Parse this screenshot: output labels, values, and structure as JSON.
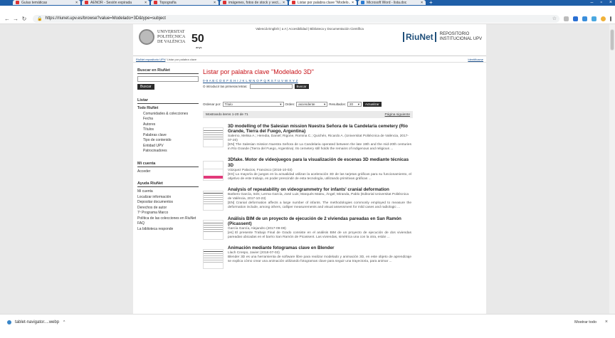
{
  "browser": {
    "tabs": [
      {
        "label": "Guías temáticas"
      },
      {
        "label": "AENOR - Sesión expirada"
      },
      {
        "label": "Topografía"
      },
      {
        "label": "imágenes, fotos de stock y vect..."
      },
      {
        "label": "Listar por palabra clave \"Modelo..."
      },
      {
        "label": "Microsoft Word - lista.doc"
      }
    ],
    "url": "https://riunet.upv.es/browse?value=Modelado+3D&type=subject"
  },
  "header": {
    "top_links": "Valencià   English  |  a A  |  Accesibilidad  |  Biblioteca y Documentación Científica",
    "upv_line1": "UNIVERSITAT",
    "upv_line2": "POLITÈCNICA",
    "upv_line3": "DE VALÈNCIA",
    "anys_number": "50",
    "anys_word": "anys",
    "riunet_brand": "RiuNet",
    "repo_line1": "REPOSITORIO",
    "repo_line2": "INSTITUCIONAL UPV"
  },
  "breadcrumb": {
    "link": "RiuNet repositorio UPV",
    "current": " / Listar por palabra clave",
    "right_link": "Identificarse"
  },
  "sidebar": {
    "search_heading": "Buscar en RiuNet",
    "search_button": "Buscar",
    "list_heading": "Listar",
    "all_label": "Todo RiuNet",
    "list_items": [
      "Comunidades & colecciones",
      "Fecha",
      "Autores",
      "Títulos",
      "Palabras clave",
      "Tipo de contenido",
      "Entidad UPV",
      "Patrocinadores"
    ],
    "account_heading": "Mi cuenta",
    "account_items": [
      "Acceder"
    ],
    "help_heading": "Ayuda RiuNet",
    "help_items": [
      "Mi cuenta",
      "Localizar información",
      "Depositar documentos",
      "Derechos de autor",
      "7º Programa Marco",
      "Política de las colecciones en RiuNet",
      "FAQ",
      "La biblioteca responde"
    ]
  },
  "main": {
    "title": "Listar por palabra clave \"Modelado 3D\"",
    "alphabet": "0-9 A B C D E F G H I J K L M N O P Q R S T U V W X Y Z",
    "jump_label": "O introducir las primeras letras:",
    "jump_button": "Buscar",
    "sort_label": "Ordenar por:",
    "sort_value": "Título",
    "order_label": "Orden:",
    "order_value": "ascendente",
    "results_label": "Resultados:",
    "results_value": "20",
    "update_button": "Actualizar",
    "showing": "Mostrando items 1-20 de 71",
    "next_page": "Página siguiente",
    "items": [
      {
        "title": "3D modelling of the Salesian mission Nuestra Señora de la Candelaria cemetery (Rio Grande, Tierra del Fuego, Argentina)",
        "meta": "Salerno, Melisa A.; Heredia, Daniel; Rigone, Romina C.; Quichén, Ricardo A. (Universitat Politècnica de València, 2017-07-20)",
        "abstract": "[EN] The Salesian mission Nuestra Señora de La Candelaria operated between the late 19th and the mid-20th centuries in Río Grande (Tierra del Fuego, Argentina). Its cemetery still holds the remains of indigenous and religious ..."
      },
      {
        "title": "3Dfake. Motor de videojuegos para la visualización de escenas 3D mediante técnicas 3D",
        "meta": "Vázquez Palacios, Francisco (2016-10-03)",
        "abstract": "[ES] La mayoría de juegos en la actualidad utilizan la aceleración 3D de las tarjetas gráficas para su funcionamiento, el objetivo de este trabajo, es poder prescindir de esta tecnología, utilizando primitivas gráficas ..."
      },
      {
        "title": "Analysis of repeatability on videogrammetry for infants' cranial deformation",
        "meta": "Barbero García, Inés; Lerma García, José Luis; Marqués Mateu, Ángel; Miranda, Pablo (Editorial Universitat Politècnica de València, 2017-10-23)",
        "abstract": "[EN] Cranial deformation affects a large number of infants. The methodologies commonly employed to measure the deformation include, among others, calliper measurements and visual assessment for mild cases and radiologic ..."
      },
      {
        "title": "Análisis BIM de un proyecto de ejecución de 2 viviendas pareadas en San Ramón (Picassent)",
        "meta": "García García, Alejandro (2017-09-08)",
        "abstract": "[es] El presente Trabajo Final de Grado consiste en el análisis BIM de un proyecto de ejecución de dos viviendas pareadas ubicadas en el barrio San Ramón de Picassent. Las viviendas, simétrica una con la otra, están ..."
      },
      {
        "title": "Animación mediante fotogramas clave en Blender",
        "meta": "Llach Crespo, Javier (2018-07-03)",
        "abstract": "Blender 3D es una herramienta de software libre para realizar modelado y animación 3D, en este objeto de aprendizaje se explica cómo crear una animación utilizando fotogramas clave para seguir una trayectoria, para animar ..."
      }
    ]
  },
  "downloads": {
    "file": "tablet-navigator....webp",
    "show_all": "Mostrar todo"
  }
}
